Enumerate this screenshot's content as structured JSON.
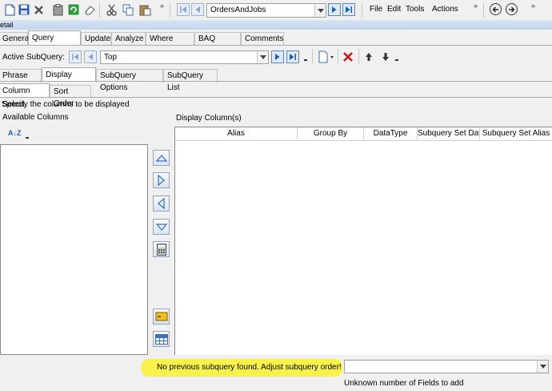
{
  "toolbar": {
    "chevron": "»",
    "query_combo_value": "OrdersAndJobs",
    "menus": [
      "File",
      "Edit",
      "Tools",
      "Actions"
    ]
  },
  "detail_label": "etail",
  "main_tabs": [
    "General",
    "Query Builder",
    "Update",
    "Analyze",
    "Where Used",
    "BAQ Search",
    "Comments"
  ],
  "subquery": {
    "label": "Active SubQuery:",
    "value": "Top"
  },
  "sub_tabs": [
    "Phrase Build",
    "Display Fields",
    "SubQuery Options",
    "SubQuery List"
  ],
  "inner_tabs": [
    "Column Select",
    "Sort Order"
  ],
  "instruction": "Specify the columns to be displayed",
  "available_columns_label": "Available Columns",
  "display_columns_label": "Display Column(s)",
  "sort_icon_text": "A↓Z",
  "grid_columns": [
    "Alias",
    "Group By",
    "DataType",
    "Subquery Set Dat",
    "Subquery Set Alias"
  ],
  "status_message": "No previous subquery found. Adjust subquery order!",
  "fields_message": "Unknown number of Fields to add",
  "colors": {
    "highlight": "#f9f24a",
    "accent_blue": "#1e5fb4",
    "delete_red": "#d0181b"
  }
}
